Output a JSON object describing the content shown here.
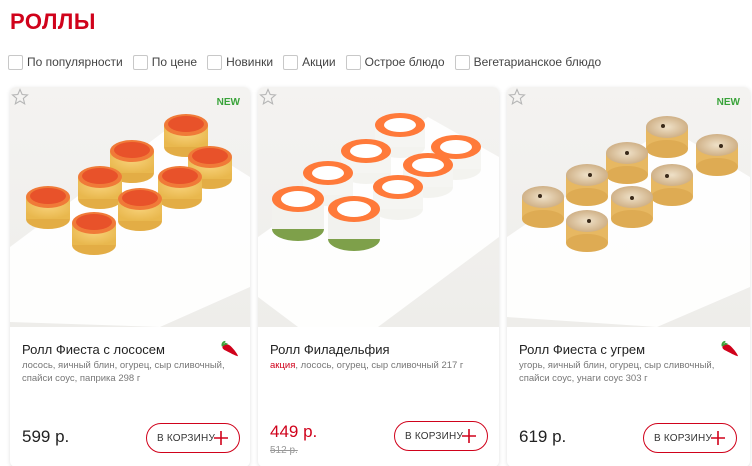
{
  "page": {
    "title": "РОЛЛЫ"
  },
  "filters": [
    {
      "label": "По популярности",
      "checked": false
    },
    {
      "label": "По цене",
      "checked": false
    },
    {
      "label": "Новинки",
      "checked": false
    },
    {
      "label": "Акции",
      "checked": false
    },
    {
      "label": "Острое блюдо",
      "checked": false
    },
    {
      "label": "Вегетарианское блюдо",
      "checked": false
    }
  ],
  "colors": {
    "accent": "#d0021b",
    "new_badge": "#3aa33a"
  },
  "products": [
    {
      "name": "Ролл Фиеста с лососем",
      "badge": "NEW",
      "spicy": true,
      "promo": "",
      "description": "лосось, яичный блин, огурец, сыр сливочный, спайси соус, паприка 298 г",
      "price": "599 р.",
      "old_price": "",
      "cart_label": "В КОРЗИНУ",
      "icon_favorite": "star-outline-icon",
      "icon_spicy": "chili-pepper-icon"
    },
    {
      "name": "Ролл Филадельфия",
      "badge": "",
      "spicy": false,
      "promo": "акция",
      "description": ", лосось, огурец, сыр сливочный 217 г",
      "price": "449 р.",
      "old_price": "512 р.",
      "cart_label": "В КОРЗИНУ",
      "icon_favorite": "star-outline-icon"
    },
    {
      "name": "Ролл Фиеста с угрем",
      "badge": "NEW",
      "spicy": true,
      "promo": "",
      "description": "угорь, яичный блин, огурец, сыр сливочный, спайси соус, унаги соус 303 г",
      "price": "619 р.",
      "old_price": "",
      "cart_label": "В КОРЗИНУ",
      "icon_favorite": "star-outline-icon",
      "icon_spicy": "chili-pepper-icon"
    }
  ]
}
